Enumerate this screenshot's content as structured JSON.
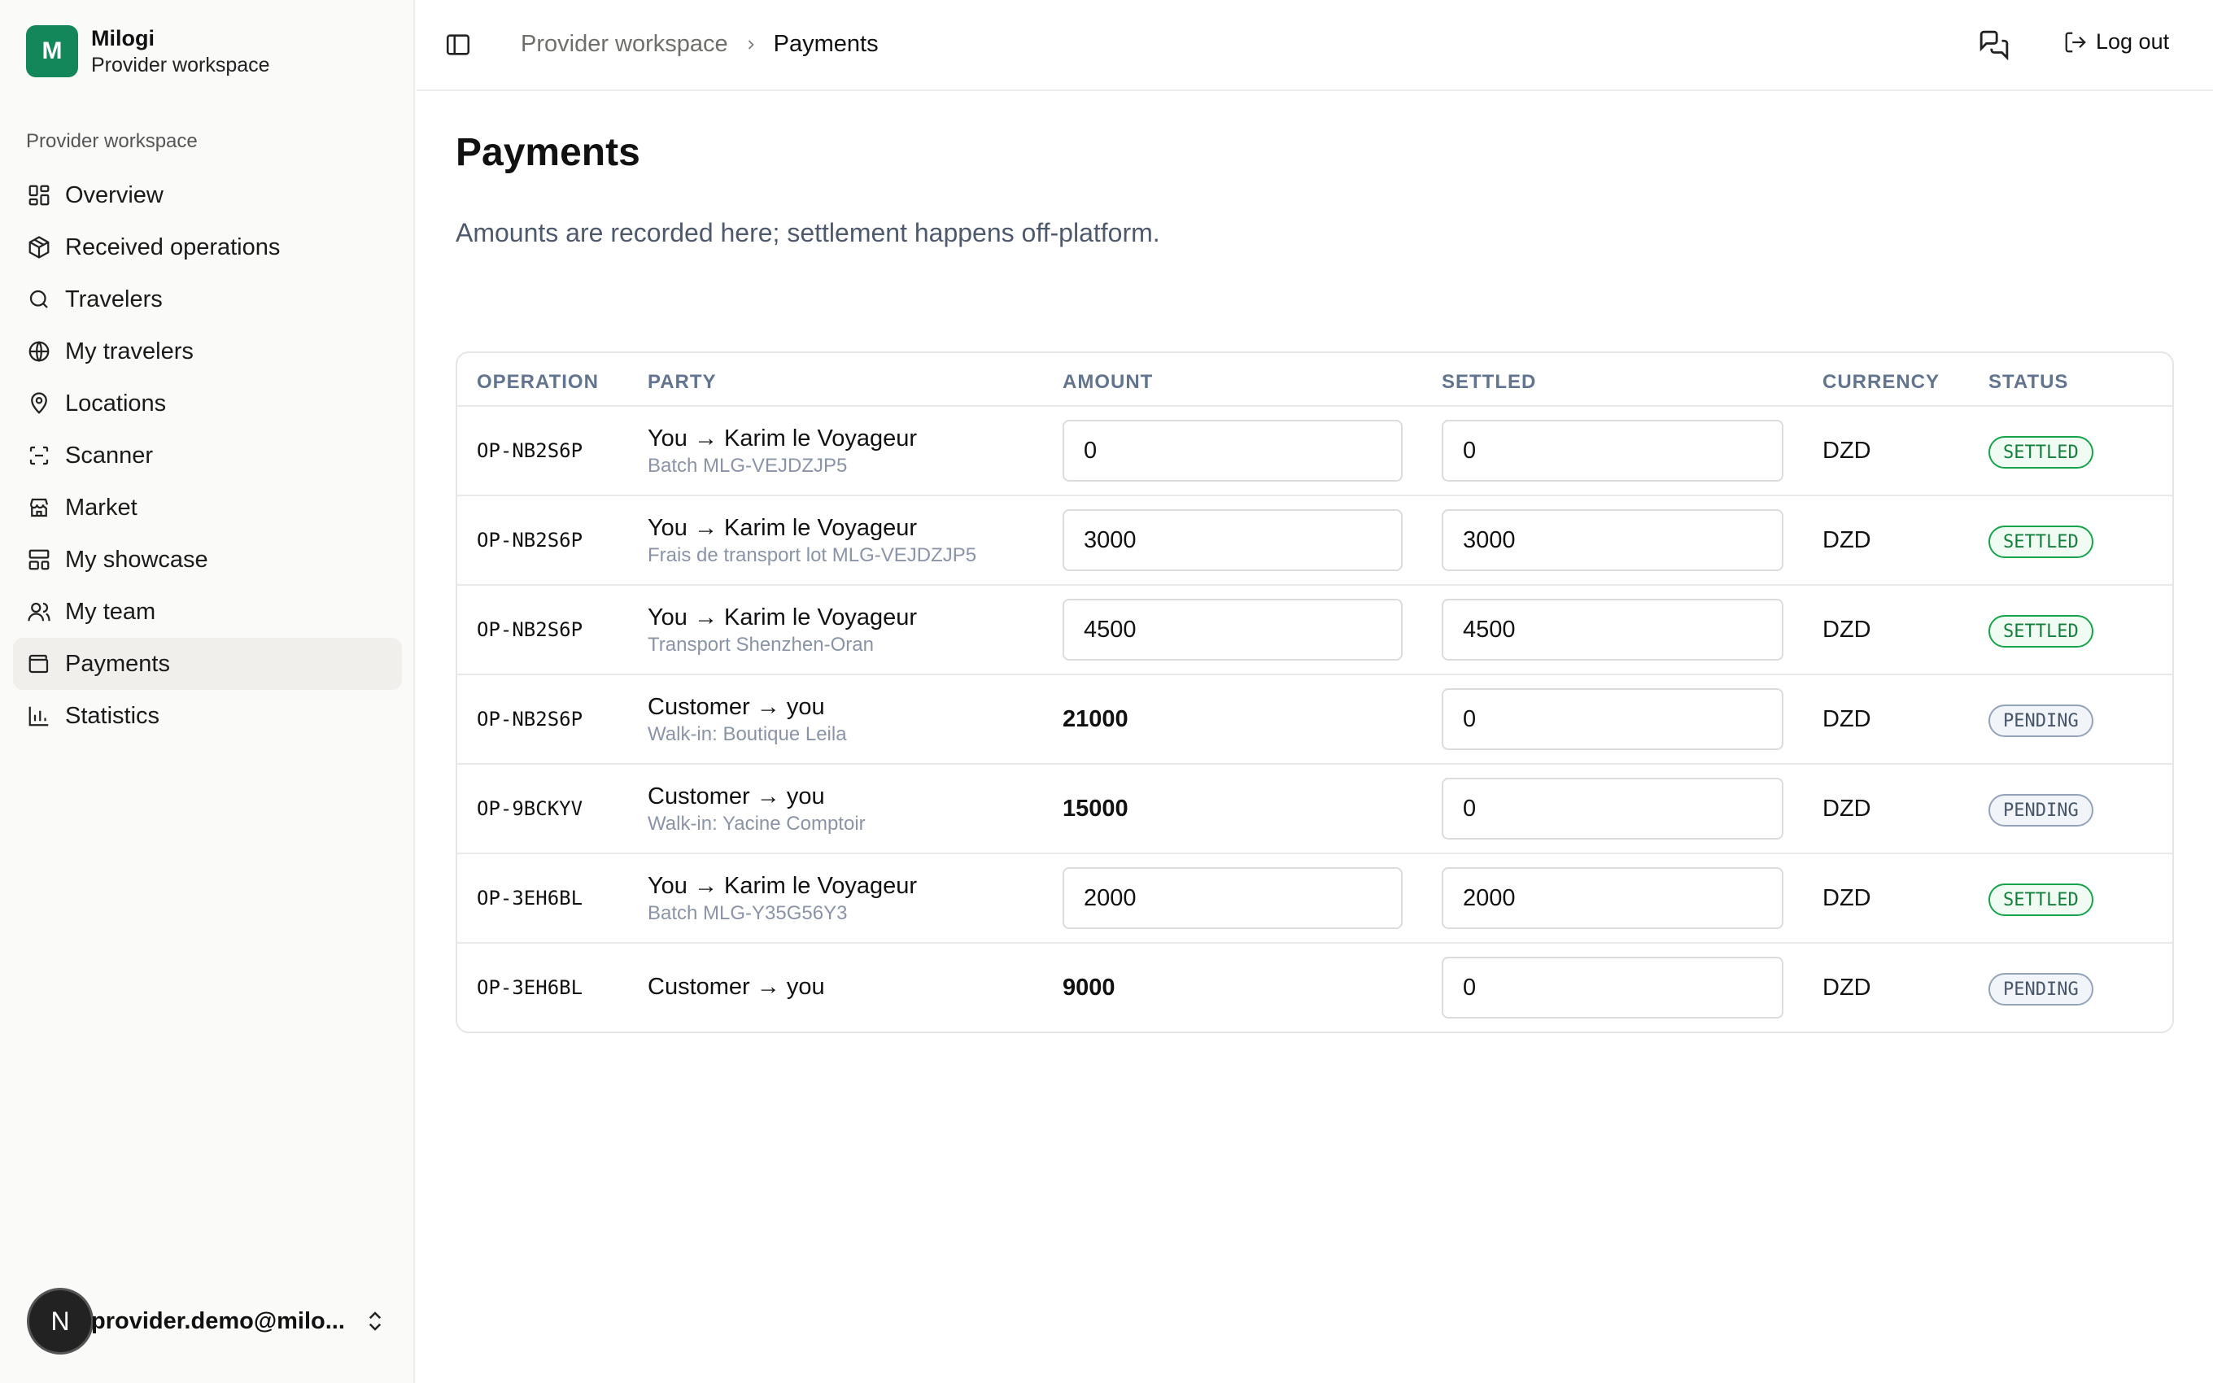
{
  "app": {
    "name": "Milogi",
    "workspace": "Provider workspace",
    "logo_letter": "M"
  },
  "sidebar": {
    "group_label": "Provider workspace",
    "items": [
      {
        "label": "Overview",
        "icon": "grid-icon"
      },
      {
        "label": "Received operations",
        "icon": "package-icon"
      },
      {
        "label": "Travelers",
        "icon": "search-icon"
      },
      {
        "label": "My travelers",
        "icon": "globe-icon"
      },
      {
        "label": "Locations",
        "icon": "map-pin-icon"
      },
      {
        "label": "Scanner",
        "icon": "scan-icon"
      },
      {
        "label": "Market",
        "icon": "store-icon"
      },
      {
        "label": "My showcase",
        "icon": "layout-icon"
      },
      {
        "label": "My team",
        "icon": "users-icon"
      },
      {
        "label": "Payments",
        "icon": "wallet-icon",
        "active": true
      },
      {
        "label": "Statistics",
        "icon": "bar-chart-icon"
      }
    ],
    "user": {
      "avatar_letter": "N",
      "email": "provider.demo@milo..."
    }
  },
  "header": {
    "breadcrumb_parent": "Provider workspace",
    "breadcrumb_current": "Payments",
    "logout_label": "Log out"
  },
  "main": {
    "title": "Payments",
    "subtitle": "Amounts are recorded here; settlement happens off-platform."
  },
  "table": {
    "columns": [
      "OPERATION",
      "PARTY",
      "AMOUNT",
      "SETTLED",
      "CURRENCY",
      "STATUS"
    ],
    "rows": [
      {
        "operation": "OP-NB2S6P",
        "party": "You → Karim le Voyageur",
        "detail": "Batch MLG-VEJDZJP5",
        "amount": "0",
        "amount_editable": true,
        "settled": "0",
        "currency": "DZD",
        "status": "SETTLED"
      },
      {
        "operation": "OP-NB2S6P",
        "party": "You → Karim le Voyageur",
        "detail": "Frais de transport lot MLG-VEJDZJP5",
        "amount": "3000",
        "amount_editable": true,
        "settled": "3000",
        "currency": "DZD",
        "status": "SETTLED"
      },
      {
        "operation": "OP-NB2S6P",
        "party": "You → Karim le Voyageur",
        "detail": "Transport Shenzhen-Oran",
        "amount": "4500",
        "amount_editable": true,
        "settled": "4500",
        "currency": "DZD",
        "status": "SETTLED"
      },
      {
        "operation": "OP-NB2S6P",
        "party": "Customer → you",
        "detail": "Walk-in: Boutique Leila",
        "amount": "21000",
        "amount_editable": false,
        "settled": "0",
        "currency": "DZD",
        "status": "PENDING"
      },
      {
        "operation": "OP-9BCKYV",
        "party": "Customer → you",
        "detail": "Walk-in: Yacine Comptoir",
        "amount": "15000",
        "amount_editable": false,
        "settled": "0",
        "currency": "DZD",
        "status": "PENDING"
      },
      {
        "operation": "OP-3EH6BL",
        "party": "You → Karim le Voyageur",
        "detail": "Batch MLG-Y35G56Y3",
        "amount": "2000",
        "amount_editable": true,
        "settled": "2000",
        "currency": "DZD",
        "status": "SETTLED"
      },
      {
        "operation": "OP-3EH6BL",
        "party": "Customer → you",
        "detail": "",
        "amount": "9000",
        "amount_editable": false,
        "settled": "0",
        "currency": "DZD",
        "status": "PENDING"
      }
    ]
  },
  "colors": {
    "brand": "#13875a",
    "settled": "#16a34a",
    "pending": "#94a3b8",
    "muted_text": "#62748e"
  }
}
